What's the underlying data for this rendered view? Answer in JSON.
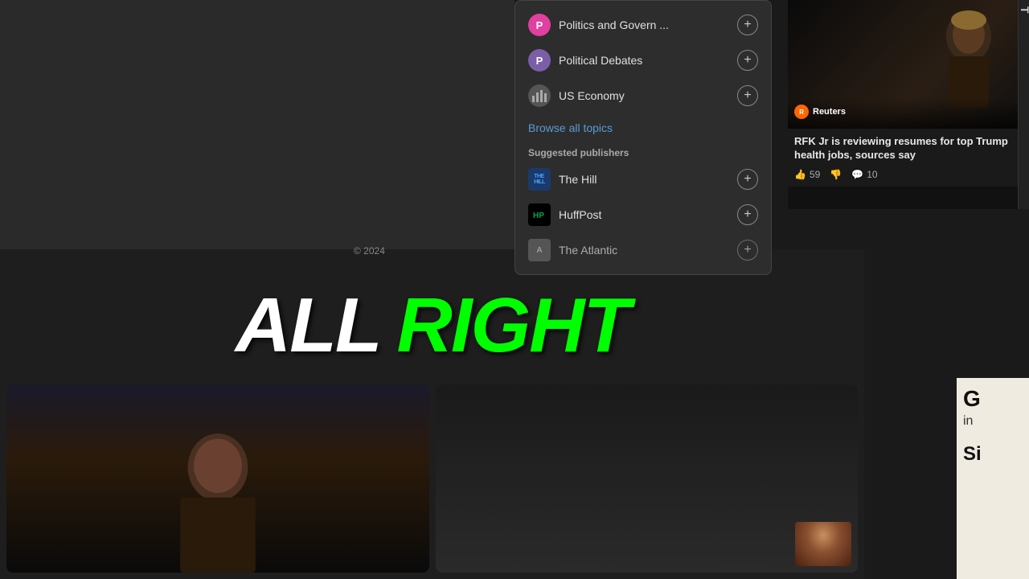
{
  "dropdown": {
    "topics": [
      {
        "id": "politics",
        "label": "Politics and Govern ...",
        "icon_type": "pink",
        "icon_text": "P"
      },
      {
        "id": "political-debates",
        "label": "Political Debates",
        "icon_type": "purple",
        "icon_text": "P"
      },
      {
        "id": "us-economy",
        "label": "US Economy",
        "icon_type": "economy",
        "icon_text": "📊"
      }
    ],
    "browse_label": "Browse all topics",
    "suggested_label": "Suggested publishers",
    "publishers": [
      {
        "id": "the-hill",
        "label": "The Hill",
        "icon_type": "hill",
        "icon_text": "THE HILL"
      },
      {
        "id": "huffpost",
        "label": "HuffPost",
        "icon_type": "huffpost",
        "icon_text": "HP"
      },
      {
        "id": "the-atlantic",
        "label": "The Atlantic",
        "icon_type": "atlantic",
        "icon_text": "A"
      }
    ]
  },
  "news_card": {
    "source": "Reuters",
    "title": "RFK Jr is reviewing resumes for top Trump health jobs, sources say",
    "likes": "59",
    "comments": "10",
    "like_icon": "👍",
    "dislike_icon": "👎",
    "comment_icon": "💬"
  },
  "copyright": "© 2024",
  "overlay": {
    "word1": "ALL",
    "word2": "RIGHT"
  },
  "bottom_right": {
    "letter1": "G",
    "text1": "in",
    "letter2": "Si"
  }
}
